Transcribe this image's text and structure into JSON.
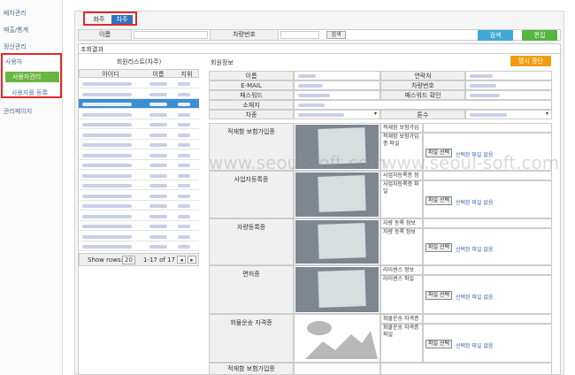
{
  "sidebar": {
    "items": [
      "배차관리",
      "매출/통계",
      "정산관리",
      "사용자",
      "사용자관리",
      "사용자를 등록",
      "관리페이지"
    ]
  },
  "tabs": [
    "화주",
    "차주"
  ],
  "search": {
    "name_label": "이름",
    "vehicle_label": "차량번호",
    "search_btn": "검색"
  },
  "actions": {
    "search": "검색",
    "edit": "편집"
  },
  "result": {
    "title": "조회결과",
    "list_title": "회원리스트(차주)",
    "columns": [
      "아이디",
      "이름",
      "지위"
    ],
    "pager": {
      "show_rows": "Show rows:",
      "rows": "20",
      "range": "1-17 of 17"
    }
  },
  "detail": {
    "title": "회원정보",
    "stop_btn": "명시 중단",
    "fields": {
      "name": "이름",
      "contact": "연락처",
      "email": "E-MAIL",
      "vehicle_no": "차량번호",
      "password": "패스워드",
      "password_confirm": "패스워드 확인",
      "address": "소재지",
      "vehicle": "차종",
      "tonnage": "톤수"
    },
    "docs": [
      {
        "label": "적재함 보험가입증",
        "f1": "적재함 보험가입",
        "f2": "적재함 보험가입증 파일"
      },
      {
        "label": "사업자등록증",
        "f1": "사업자등록증 정",
        "f2": "사업자등록증 파일"
      },
      {
        "label": "자량등록증",
        "f1": "자량 등록 정보",
        "f2": "자량 등록 정보"
      },
      {
        "label": "면허증",
        "f1": "라이센스 정보",
        "f2": "라이센스 파일"
      },
      {
        "label": "화물운송 자격증",
        "f1": "화물운송 자격증",
        "f2": "화물운송 자격증 파일"
      },
      {
        "label": "적재함 보험가입증",
        "f1": "",
        "f2": ""
      }
    ],
    "file_btn": "파일 선택",
    "no_file": "선택된 파일 없음"
  },
  "watermark": [
    "www.seoul-soft.com",
    "www.seoul-soft.com"
  ],
  "colors": {
    "accent": "#e02a2a",
    "green": "#6ab53f",
    "blue": "#3498db",
    "orange": "#f39c12",
    "select": "#3a8fd1"
  }
}
